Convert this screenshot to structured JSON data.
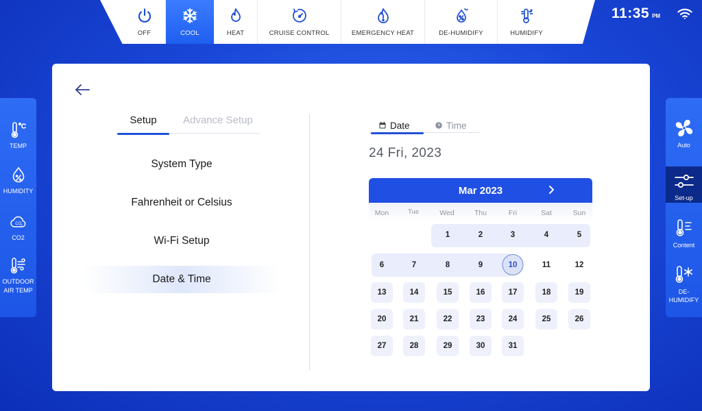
{
  "modes": [
    {
      "label": "OFF",
      "icon": "power-icon",
      "active": false
    },
    {
      "label": "COOL",
      "icon": "snowflake-icon",
      "active": true
    },
    {
      "label": "HEAT",
      "icon": "flame-icon",
      "active": false
    },
    {
      "label": "CRUISE CONTROL",
      "icon": "gauge-icon",
      "active": false
    },
    {
      "label": "EMERGENCY HEAT",
      "icon": "emergency-flame-icon",
      "active": false
    },
    {
      "label": "DE-HUMIDIFY",
      "icon": "dehumidify-icon",
      "active": false
    },
    {
      "label": "HUMIDIFY",
      "icon": "humidify-icon",
      "active": false
    }
  ],
  "status": {
    "time": "11:35",
    "ampm": "PM",
    "wifi_icon": "wifi-icon"
  },
  "left_sidebar": [
    {
      "label": "TEMP",
      "icon": "thermometer-celsius-icon"
    },
    {
      "label": "HUMIDITY",
      "icon": "humidity-drop-icon"
    },
    {
      "label": "CO2",
      "icon": "co2-cloud-icon"
    },
    {
      "label_line1": "OUTDOOR",
      "label_line2": "AIR TEMP",
      "icon": "outdoor-temp-icon"
    }
  ],
  "right_sidebar": [
    {
      "label": "Auto",
      "icon": "fan-icon",
      "active": false
    },
    {
      "label": "Set-up",
      "icon": "sliders-icon",
      "active": true
    },
    {
      "label": "Content",
      "icon": "thermometer-lines-icon",
      "active": false
    },
    {
      "label_line1": "DE-",
      "label_line2": "HUMIDIFY",
      "icon": "thermometer-snow-icon",
      "active": false
    }
  ],
  "setup": {
    "tabs": {
      "setup": "Setup",
      "advance": "Advance Setup"
    },
    "menu": [
      "System Type",
      "Fahrenheit or Celsius",
      "Wi-Fi Setup",
      "Date & Time"
    ],
    "active_menu": "Date & Time"
  },
  "datetime": {
    "tabs": {
      "date": "Date",
      "time": "Time"
    },
    "selected_date_text": "24 Fri, 2023",
    "calendar": {
      "month_label": "Mar 2023",
      "weekdays": [
        "Mon",
        "Tue",
        "Wed",
        "Thu",
        "Fri",
        "Sat",
        "Sun"
      ],
      "weeks": [
        [
          "",
          "",
          "1",
          "2",
          "3",
          "4",
          "5"
        ],
        [
          "6",
          "7",
          "8",
          "9",
          "10",
          "11",
          "12"
        ],
        [
          "13",
          "14",
          "15",
          "16",
          "17",
          "18",
          "19"
        ],
        [
          "20",
          "21",
          "22",
          "23",
          "24",
          "25",
          "26"
        ],
        [
          "27",
          "28",
          "29",
          "30",
          "31",
          "",
          ""
        ]
      ],
      "today": "10"
    }
  },
  "colors": {
    "accent": "#1f4fe3",
    "background": "#1a47d8",
    "panel": "#ffffff"
  }
}
